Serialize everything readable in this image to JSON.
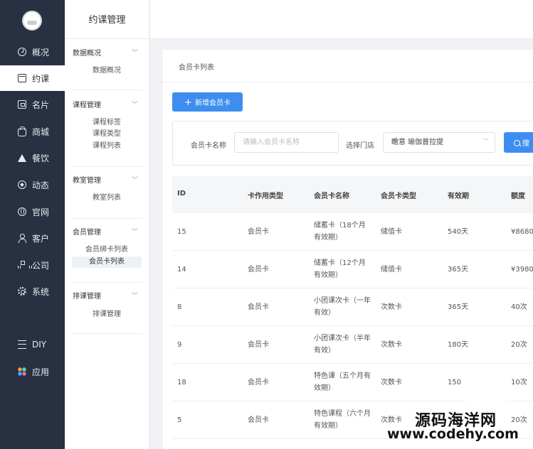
{
  "sidebar": {
    "items": [
      {
        "label": "概况",
        "icon": "dashboard-icon"
      },
      {
        "label": "约课",
        "icon": "calendar-icon",
        "active": true
      },
      {
        "label": "名片",
        "icon": "card-icon"
      },
      {
        "label": "商城",
        "icon": "shop-icon"
      },
      {
        "label": "餐饮",
        "icon": "food-icon"
      },
      {
        "label": "动态",
        "icon": "compass-icon"
      },
      {
        "label": "官网",
        "icon": "globe-icon"
      },
      {
        "label": "客户",
        "icon": "user-icon"
      },
      {
        "label": "公司",
        "icon": "org-icon"
      },
      {
        "label": "系统",
        "icon": "gear-icon"
      },
      {
        "label": "DIY",
        "icon": "diy-icon"
      },
      {
        "label": "应用",
        "icon": "apps-icon"
      }
    ]
  },
  "subnav": {
    "title": "约课管理",
    "groups": [
      {
        "title": "数据概况",
        "items": [
          "数据概况"
        ]
      },
      {
        "title": "课程管理",
        "items": [
          "课程标签",
          "课程类型",
          "课程列表"
        ]
      },
      {
        "title": "教室管理",
        "items": [
          "教室列表"
        ]
      },
      {
        "title": "会员管理",
        "items": [
          "会员绑卡列表",
          "会员卡列表"
        ]
      },
      {
        "title": "排课管理",
        "items": [
          "排课管理"
        ]
      }
    ]
  },
  "main": {
    "title": "会员卡列表",
    "add_button": "新增会员卡",
    "filter": {
      "name_label": "会员卡名称",
      "name_placeholder": "请输入会员卡名称",
      "store_label": "选择门店",
      "store_value": "瞻意 瑜伽普拉提",
      "search_button": "搜"
    },
    "table": {
      "headers": [
        "ID",
        "卡作用类型",
        "会员卡名称",
        "会员卡类型",
        "有效期",
        "额度"
      ],
      "rows": [
        [
          "15",
          "会员卡",
          "储蓄卡（18个月有效期）",
          "储值卡",
          "540天",
          "¥8680"
        ],
        [
          "14",
          "会员卡",
          "储蓄卡（12个月有效期）",
          "储值卡",
          "365天",
          "¥3980"
        ],
        [
          "8",
          "会员卡",
          "小团课次卡（一年有效）",
          "次数卡",
          "365天",
          "40次"
        ],
        [
          "9",
          "会员卡",
          "小团课次卡（半年有效）",
          "次数卡",
          "180天",
          "20次"
        ],
        [
          "18",
          "会员卡",
          "特色课（五个月有效期）",
          "次数卡",
          "150",
          "10次"
        ],
        [
          "5",
          "会员卡",
          "特色课程（六个月有效期）",
          "次数卡",
          "",
          "20次"
        ]
      ]
    }
  },
  "watermark": {
    "cn": "源码海洋网",
    "url": "www.codehy.com"
  },
  "colors": {
    "sidebar_bg": "#273142",
    "primary": "#3d8ef0"
  }
}
